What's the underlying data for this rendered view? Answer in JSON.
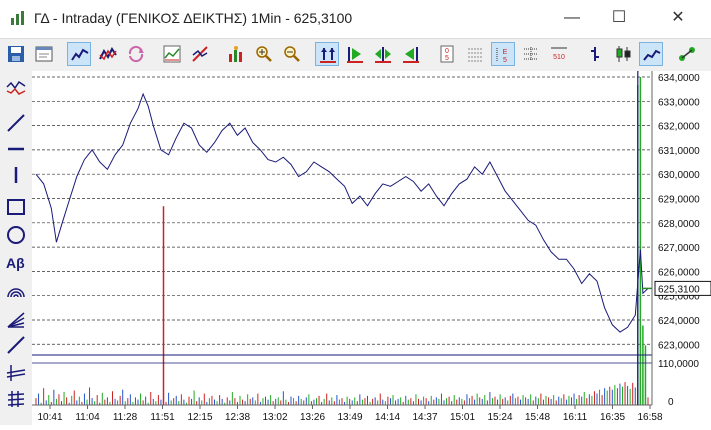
{
  "window": {
    "title": "ΓΔ - Intraday (ΓΕΝΙΚΟΣ ΔΕΙΚΤΗΣ) 1Min - 625,3100",
    "minimize_glyph": "—",
    "maximize_glyph": "☐",
    "close_glyph": "✕"
  },
  "toolbar": {
    "buttons": [
      "save-icon",
      "window-icon",
      "chart-style-icon",
      "compare-icon",
      "refresh-icon",
      "indicators-icon",
      "trendline-icon",
      "volume-icon",
      "zoom-in-icon",
      "zoom-out-icon",
      "fit-icon",
      "go-start-icon",
      "center-icon",
      "go-end-icon",
      "tick-5-icon",
      "grid-icon",
      "scale-5-icon",
      "scale-510-icon",
      "bar-chart-icon",
      "candle-icon",
      "line-chart-icon",
      "link-icon"
    ]
  },
  "sidebar": {
    "tools": [
      "indicator-tool-icon",
      "line-tool-icon",
      "hline-tool-icon",
      "vline-tool-icon",
      "rectangle-tool-icon",
      "ellipse-tool-icon",
      "text-tool-icon",
      "arc-tool-icon",
      "fan-tool-icon",
      "channel-tool-icon",
      "fibonacci-tool-icon",
      "grid-tool-icon"
    ],
    "text_tool_label": "Aβ"
  },
  "chart_data": {
    "type": "line",
    "price_axis_labels": [
      "634,0000",
      "633,0000",
      "632,0000",
      "631,0000",
      "630,0000",
      "629,0000",
      "628,0000",
      "627,0000",
      "626,0000",
      "625,0000",
      "624,0000",
      "623,0000"
    ],
    "current_price_label": "625,3100",
    "ylim": [
      622.6,
      634.0
    ],
    "volume_axis_labels": [
      "110,0000",
      "0"
    ],
    "x_tick_labels": [
      "10:41",
      "11:04",
      "11:28",
      "11:51",
      "12:15",
      "12:38",
      "13:02",
      "13:26",
      "13:49",
      "14:14",
      "14:37",
      "15:01",
      "15:24",
      "15:48",
      "16:11",
      "16:35",
      "16:58"
    ],
    "grid": true,
    "price_series": [
      [
        0,
        630.0
      ],
      [
        3,
        629.6
      ],
      [
        6,
        628.6
      ],
      [
        8,
        627.2
      ],
      [
        10,
        627.9
      ],
      [
        13,
        628.9
      ],
      [
        16,
        629.9
      ],
      [
        19,
        630.6
      ],
      [
        22,
        631.0
      ],
      [
        25,
        630.5
      ],
      [
        28,
        630.2
      ],
      [
        31,
        630.8
      ],
      [
        34,
        631.2
      ],
      [
        37,
        632.1
      ],
      [
        40,
        632.7
      ],
      [
        42,
        633.3
      ],
      [
        44,
        632.8
      ],
      [
        46,
        632.0
      ],
      [
        49,
        631.0
      ],
      [
        52,
        630.8
      ],
      [
        55,
        631.5
      ],
      [
        58,
        632.1
      ],
      [
        61,
        631.9
      ],
      [
        64,
        631.2
      ],
      [
        67,
        630.9
      ],
      [
        70,
        631.3
      ],
      [
        73,
        631.8
      ],
      [
        76,
        632.1
      ],
      [
        79,
        631.6
      ],
      [
        82,
        631.9
      ],
      [
        85,
        631.3
      ],
      [
        88,
        631.0
      ],
      [
        91,
        630.6
      ],
      [
        94,
        630.5
      ],
      [
        97,
        630.7
      ],
      [
        100,
        630.4
      ],
      [
        103,
        629.9
      ],
      [
        106,
        630.1
      ],
      [
        109,
        630.5
      ],
      [
        112,
        630.3
      ],
      [
        115,
        630.1
      ],
      [
        118,
        629.8
      ],
      [
        121,
        629.5
      ],
      [
        124,
        628.8
      ],
      [
        127,
        629.1
      ],
      [
        130,
        628.7
      ],
      [
        133,
        629.2
      ],
      [
        136,
        629.6
      ],
      [
        139,
        629.5
      ],
      [
        142,
        629.7
      ],
      [
        145,
        629.9
      ],
      [
        148,
        629.7
      ],
      [
        151,
        629.3
      ],
      [
        154,
        629.6
      ],
      [
        157,
        629.1
      ],
      [
        160,
        628.7
      ],
      [
        163,
        629.2
      ],
      [
        166,
        629.6
      ],
      [
        169,
        629.8
      ],
      [
        172,
        630.3
      ],
      [
        175,
        630.0
      ],
      [
        178,
        630.5
      ],
      [
        181,
        629.9
      ],
      [
        184,
        629.3
      ],
      [
        187,
        628.9
      ],
      [
        190,
        628.5
      ],
      [
        193,
        628.1
      ],
      [
        196,
        627.9
      ],
      [
        199,
        627.3
      ],
      [
        202,
        626.8
      ],
      [
        205,
        626.5
      ],
      [
        208,
        626.5
      ],
      [
        211,
        626.1
      ],
      [
        214,
        625.5
      ],
      [
        217,
        625.9
      ],
      [
        220,
        625.6
      ],
      [
        223,
        624.5
      ],
      [
        226,
        623.8
      ],
      [
        229,
        623.5
      ],
      [
        232,
        623.7
      ],
      [
        235,
        624.2
      ],
      [
        237,
        626.9
      ],
      [
        238,
        625.1
      ],
      [
        240,
        625.3
      ]
    ],
    "volume_series": [
      [
        0,
        18
      ],
      [
        1,
        30
      ],
      [
        2,
        6
      ],
      [
        3,
        44
      ],
      [
        4,
        12
      ],
      [
        5,
        26
      ],
      [
        6,
        8
      ],
      [
        7,
        40
      ],
      [
        8,
        16
      ],
      [
        9,
        28
      ],
      [
        10,
        10
      ],
      [
        11,
        34
      ],
      [
        12,
        20
      ],
      [
        13,
        6
      ],
      [
        14,
        24
      ],
      [
        15,
        38
      ],
      [
        16,
        12
      ],
      [
        17,
        22
      ],
      [
        18,
        8
      ],
      [
        19,
        30
      ],
      [
        20,
        14
      ],
      [
        21,
        46
      ],
      [
        22,
        18
      ],
      [
        23,
        10
      ],
      [
        24,
        26
      ],
      [
        25,
        6
      ],
      [
        26,
        32
      ],
      [
        27,
        14
      ],
      [
        28,
        20
      ],
      [
        29,
        8
      ],
      [
        30,
        36
      ],
      [
        31,
        16
      ],
      [
        32,
        12
      ],
      [
        33,
        24
      ],
      [
        34,
        40
      ],
      [
        35,
        10
      ],
      [
        36,
        18
      ],
      [
        37,
        28
      ],
      [
        38,
        8
      ],
      [
        39,
        20
      ],
      [
        40,
        14
      ],
      [
        41,
        30
      ],
      [
        42,
        12
      ],
      [
        43,
        22
      ],
      [
        44,
        6
      ],
      [
        45,
        34
      ],
      [
        46,
        16
      ],
      [
        47,
        10
      ],
      [
        48,
        26
      ],
      [
        49,
        14
      ],
      [
        50,
        20
      ],
      [
        51,
        8
      ],
      [
        52,
        32
      ],
      [
        53,
        12
      ],
      [
        54,
        18
      ],
      [
        55,
        24
      ],
      [
        56,
        10
      ],
      [
        57,
        28
      ],
      [
        58,
        14
      ],
      [
        59,
        6
      ],
      [
        60,
        22
      ],
      [
        61,
        16
      ],
      [
        62,
        38
      ],
      [
        63,
        10
      ],
      [
        64,
        20
      ],
      [
        65,
        12
      ],
      [
        66,
        30
      ],
      [
        67,
        8
      ],
      [
        68,
        18
      ],
      [
        69,
        24
      ],
      [
        70,
        14
      ],
      [
        71,
        10
      ],
      [
        72,
        26
      ],
      [
        73,
        16
      ],
      [
        74,
        6
      ],
      [
        75,
        20
      ],
      [
        76,
        12
      ],
      [
        77,
        34
      ],
      [
        78,
        18
      ],
      [
        79,
        8
      ],
      [
        80,
        24
      ],
      [
        81,
        14
      ],
      [
        82,
        10
      ],
      [
        83,
        28
      ],
      [
        84,
        16
      ],
      [
        85,
        20
      ],
      [
        86,
        12
      ],
      [
        87,
        30
      ],
      [
        88,
        8
      ],
      [
        89,
        18
      ],
      [
        90,
        22
      ],
      [
        91,
        14
      ],
      [
        92,
        26
      ],
      [
        93,
        10
      ],
      [
        94,
        16
      ],
      [
        95,
        20
      ],
      [
        96,
        12
      ],
      [
        97,
        36
      ],
      [
        98,
        14
      ],
      [
        99,
        8
      ],
      [
        100,
        22
      ],
      [
        101,
        18
      ],
      [
        102,
        10
      ],
      [
        103,
        24
      ],
      [
        104,
        16
      ],
      [
        105,
        12
      ],
      [
        106,
        20
      ],
      [
        107,
        28
      ],
      [
        108,
        10
      ],
      [
        109,
        14
      ],
      [
        110,
        18
      ],
      [
        111,
        24
      ],
      [
        112,
        8
      ],
      [
        113,
        16
      ],
      [
        114,
        30
      ],
      [
        115,
        12
      ],
      [
        116,
        20
      ],
      [
        117,
        10
      ],
      [
        118,
        26
      ],
      [
        119,
        14
      ],
      [
        120,
        18
      ],
      [
        121,
        8
      ],
      [
        122,
        22
      ],
      [
        123,
        16
      ],
      [
        124,
        12
      ],
      [
        125,
        20
      ],
      [
        126,
        10
      ],
      [
        127,
        28
      ],
      [
        128,
        14
      ],
      [
        129,
        18
      ],
      [
        130,
        24
      ],
      [
        131,
        8
      ],
      [
        132,
        16
      ],
      [
        133,
        20
      ],
      [
        134,
        12
      ],
      [
        135,
        30
      ],
      [
        136,
        14
      ],
      [
        137,
        10
      ],
      [
        138,
        22
      ],
      [
        139,
        18
      ],
      [
        140,
        26
      ],
      [
        141,
        12
      ],
      [
        142,
        16
      ],
      [
        143,
        20
      ],
      [
        144,
        8
      ],
      [
        145,
        24
      ],
      [
        146,
        14
      ],
      [
        147,
        18
      ],
      [
        148,
        10
      ],
      [
        149,
        28
      ],
      [
        150,
        16
      ],
      [
        151,
        12
      ],
      [
        152,
        22
      ],
      [
        153,
        18
      ],
      [
        154,
        10
      ],
      [
        155,
        24
      ],
      [
        156,
        14
      ],
      [
        157,
        20
      ],
      [
        158,
        16
      ],
      [
        159,
        30
      ],
      [
        160,
        12
      ],
      [
        161,
        18
      ],
      [
        162,
        22
      ],
      [
        163,
        10
      ],
      [
        164,
        26
      ],
      [
        165,
        14
      ],
      [
        166,
        20
      ],
      [
        167,
        16
      ],
      [
        168,
        12
      ],
      [
        169,
        28
      ],
      [
        170,
        18
      ],
      [
        171,
        24
      ],
      [
        172,
        14
      ],
      [
        173,
        30
      ],
      [
        174,
        20
      ],
      [
        175,
        16
      ],
      [
        176,
        26
      ],
      [
        177,
        12
      ],
      [
        178,
        34
      ],
      [
        179,
        18
      ],
      [
        180,
        22
      ],
      [
        181,
        14
      ],
      [
        182,
        28
      ],
      [
        183,
        16
      ],
      [
        184,
        20
      ],
      [
        185,
        12
      ],
      [
        186,
        24
      ],
      [
        187,
        30
      ],
      [
        188,
        18
      ],
      [
        189,
        22
      ],
      [
        190,
        14
      ],
      [
        191,
        26
      ],
      [
        192,
        20
      ],
      [
        193,
        16
      ],
      [
        194,
        28
      ],
      [
        195,
        12
      ],
      [
        196,
        22
      ],
      [
        197,
        18
      ],
      [
        198,
        30
      ],
      [
        199,
        14
      ],
      [
        200,
        24
      ],
      [
        201,
        20
      ],
      [
        202,
        16
      ],
      [
        203,
        26
      ],
      [
        204,
        12
      ],
      [
        205,
        22
      ],
      [
        206,
        18
      ],
      [
        207,
        28
      ],
      [
        208,
        14
      ],
      [
        209,
        24
      ],
      [
        210,
        20
      ],
      [
        211,
        30
      ],
      [
        212,
        16
      ],
      [
        213,
        26
      ],
      [
        214,
        22
      ],
      [
        215,
        34
      ],
      [
        216,
        18
      ],
      [
        217,
        28
      ],
      [
        218,
        24
      ],
      [
        219,
        36
      ],
      [
        220,
        30
      ],
      [
        221,
        40
      ],
      [
        222,
        26
      ],
      [
        223,
        44
      ],
      [
        224,
        38
      ],
      [
        225,
        48
      ],
      [
        226,
        40
      ],
      [
        227,
        52
      ],
      [
        228,
        44
      ],
      [
        229,
        56
      ],
      [
        230,
        48
      ],
      [
        231,
        60
      ],
      [
        232,
        50
      ],
      [
        233,
        42
      ],
      [
        234,
        58
      ],
      [
        235,
        46
      ],
      [
        236,
        62
      ],
      [
        237,
        70
      ],
      [
        238,
        54
      ],
      [
        239,
        40
      ],
      [
        240,
        20
      ]
    ],
    "volume_spikes": [
      [
        50,
        200
      ],
      [
        236,
        322
      ],
      [
        237,
        330
      ],
      [
        238,
        80
      ],
      [
        239,
        60
      ]
    ],
    "line_color": "#1a1a78",
    "volume_up_color": "#22aa22",
    "volume_down_color": "#cc2222",
    "volume_neutral_color": "#2255cc"
  }
}
